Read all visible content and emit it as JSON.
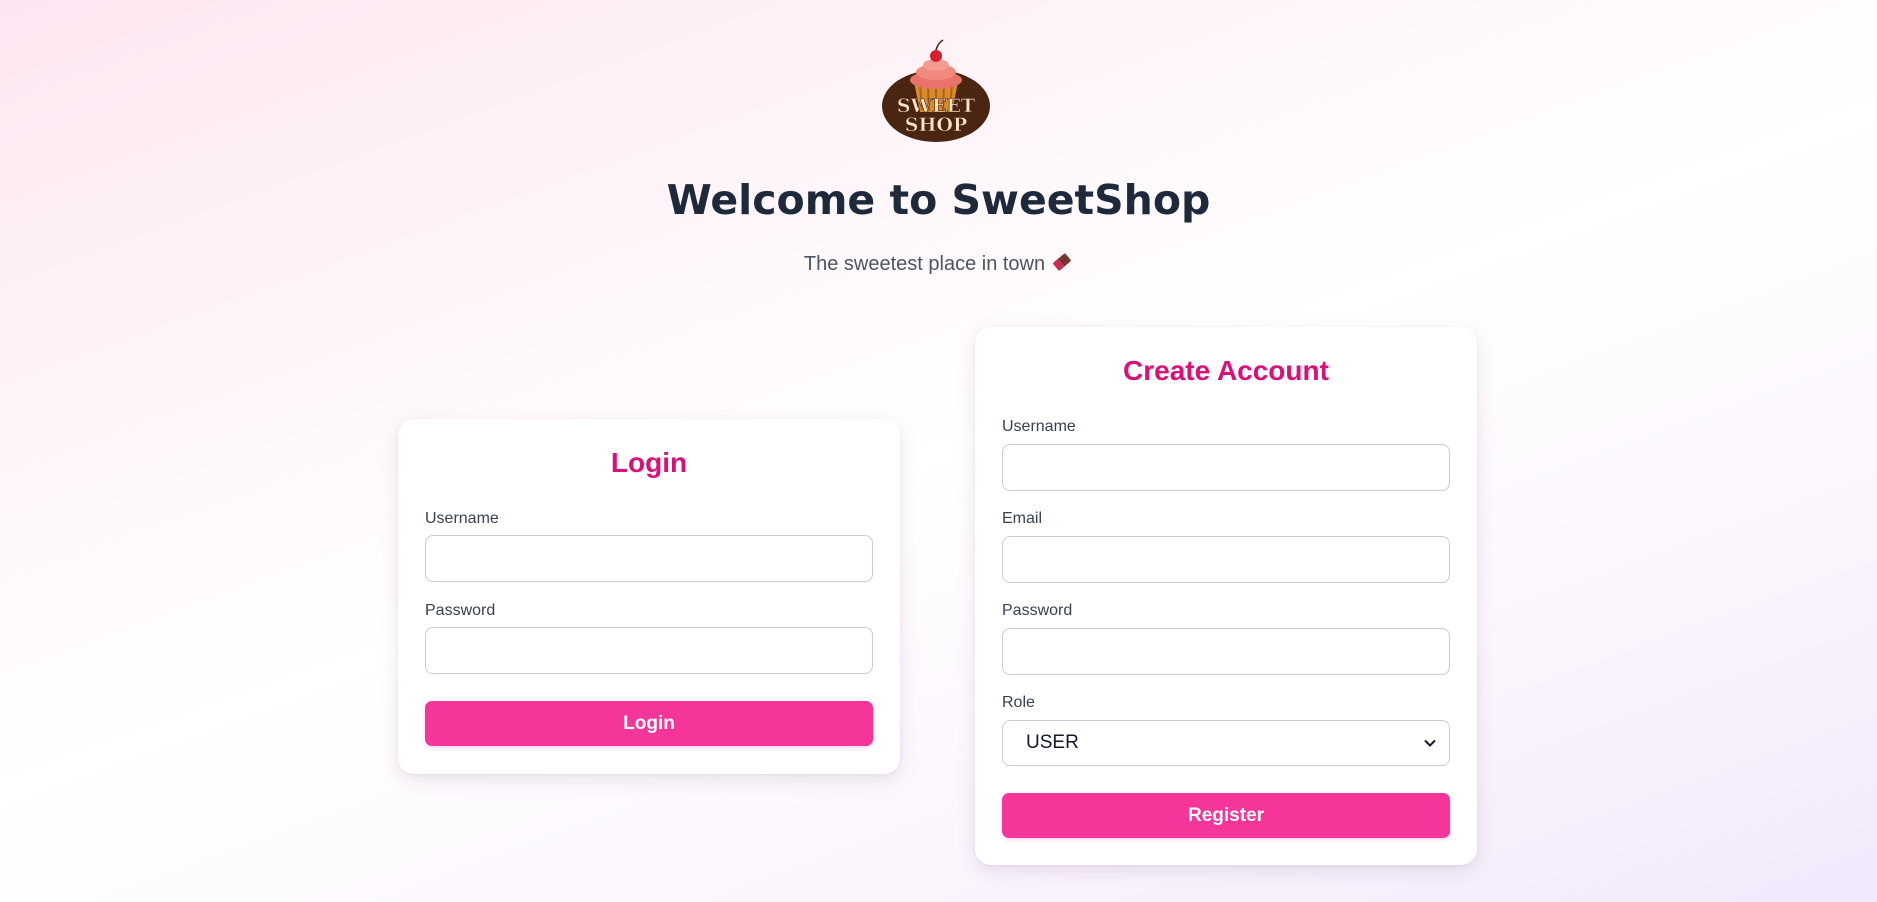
{
  "header": {
    "logo_text_line1": "SWEET",
    "logo_text_line2": "SHOP",
    "title": "Welcome to SweetShop",
    "subtitle": "The sweetest place in town",
    "subtitle_icon": "chocolate-bar-icon"
  },
  "login": {
    "heading": "Login",
    "username_label": "Username",
    "username_value": "",
    "password_label": "Password",
    "password_value": "",
    "submit_label": "Login"
  },
  "register": {
    "heading": "Create Account",
    "username_label": "Username",
    "username_value": "",
    "email_label": "Email",
    "email_value": "",
    "password_label": "Password",
    "password_value": "",
    "role_label": "Role",
    "role_value": "USER",
    "submit_label": "Register"
  },
  "colors": {
    "accent": "#f5359a",
    "heading_pink": "#db0f78",
    "title_dark": "#1e293b"
  }
}
